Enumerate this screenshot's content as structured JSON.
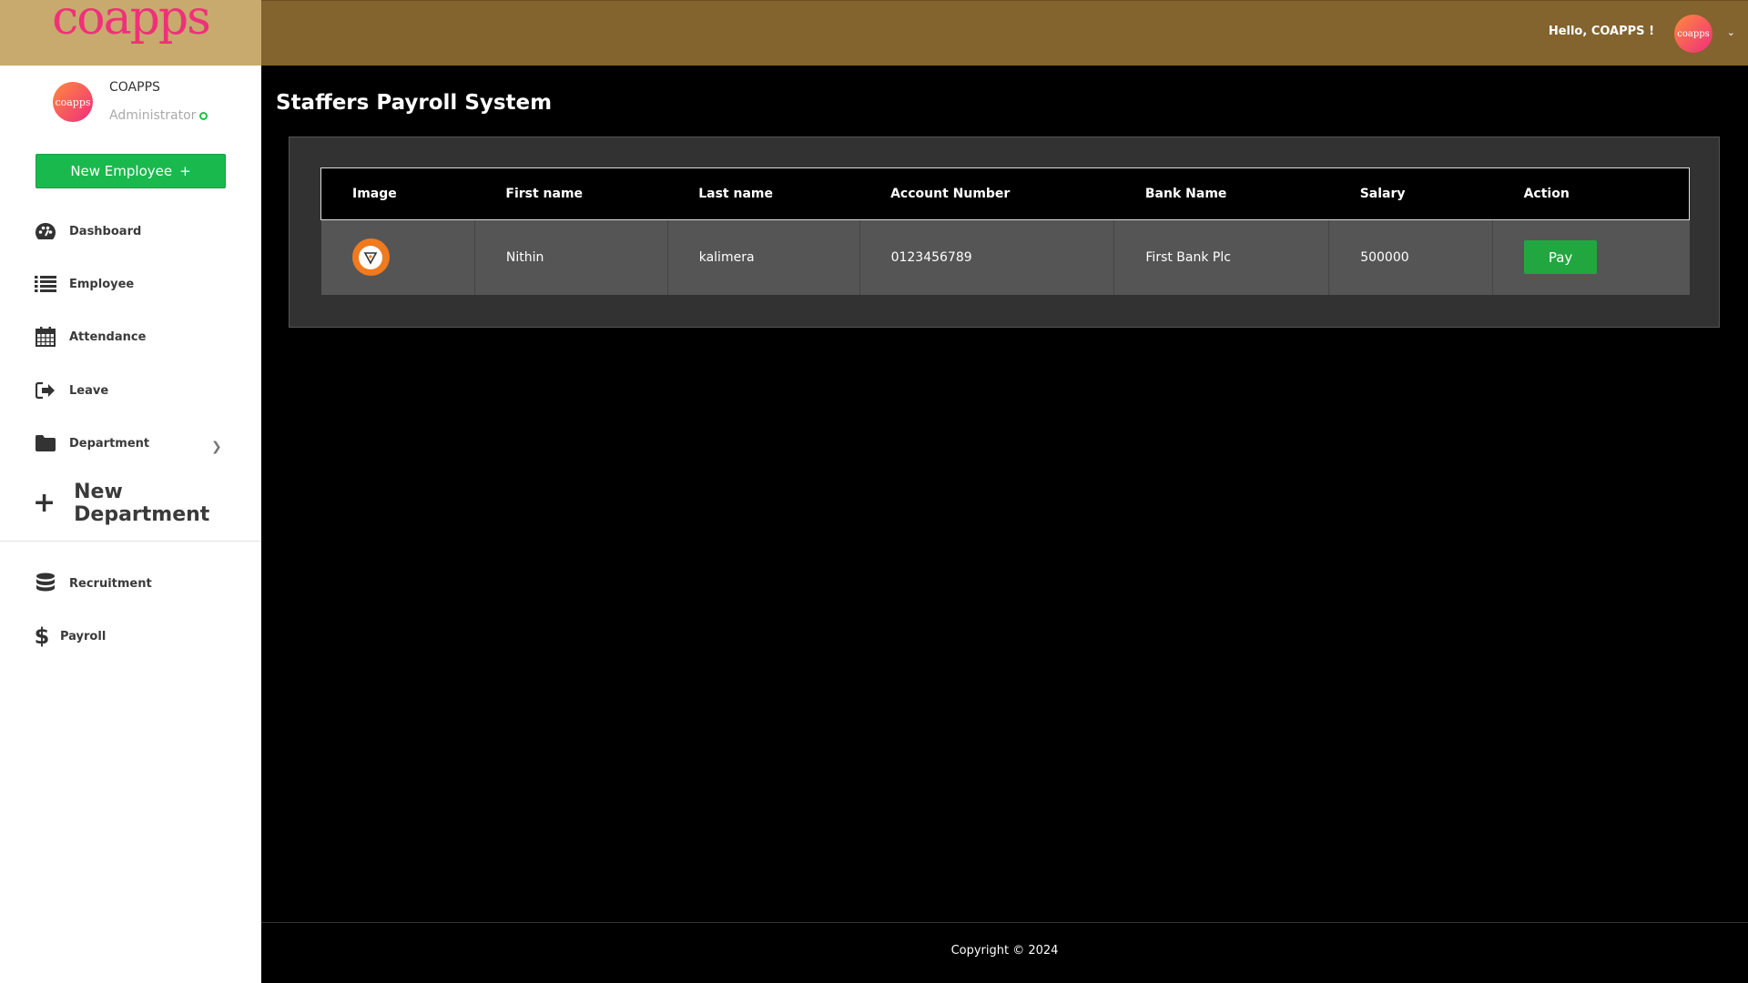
{
  "brand": {
    "logo_text": "coapps",
    "accent": "#f0307a"
  },
  "user": {
    "name": "COAPPS",
    "role": "Administrator",
    "avatar_text": "coapps",
    "status_color": "#1ec14b"
  },
  "sidebar": {
    "new_employee_label": "New Employee",
    "items": [
      {
        "label": "Dashboard",
        "icon": "palette-icon"
      },
      {
        "label": "Employee",
        "icon": "list-icon"
      },
      {
        "label": "Attendance",
        "icon": "calendar-icon"
      },
      {
        "label": "Leave",
        "icon": "sign-out-icon"
      },
      {
        "label": "Department",
        "icon": "folder-icon"
      }
    ],
    "new_department_label": "New Department",
    "bottom_items": [
      {
        "label": "Recruitment",
        "icon": "database-icon"
      },
      {
        "label": "Payroll",
        "icon": "dollar-icon"
      }
    ]
  },
  "topbar": {
    "greeting": "Hello, COAPPS !",
    "avatar_text": "coapps",
    "bg_color": "#83632e"
  },
  "page": {
    "title": "Staffers Payroll System"
  },
  "table": {
    "headers": [
      "Image",
      "First name",
      "Last name",
      "Account Number",
      "Bank Name",
      "Salary",
      "Action"
    ],
    "rows": [
      {
        "first_name": "Nithin",
        "last_name": "kalimera",
        "account_number": "0123456789",
        "bank_name": "First Bank Plc",
        "salary": "500000",
        "action_label": "Pay"
      }
    ]
  },
  "footer": {
    "copyright": "Copyright © 2024"
  }
}
